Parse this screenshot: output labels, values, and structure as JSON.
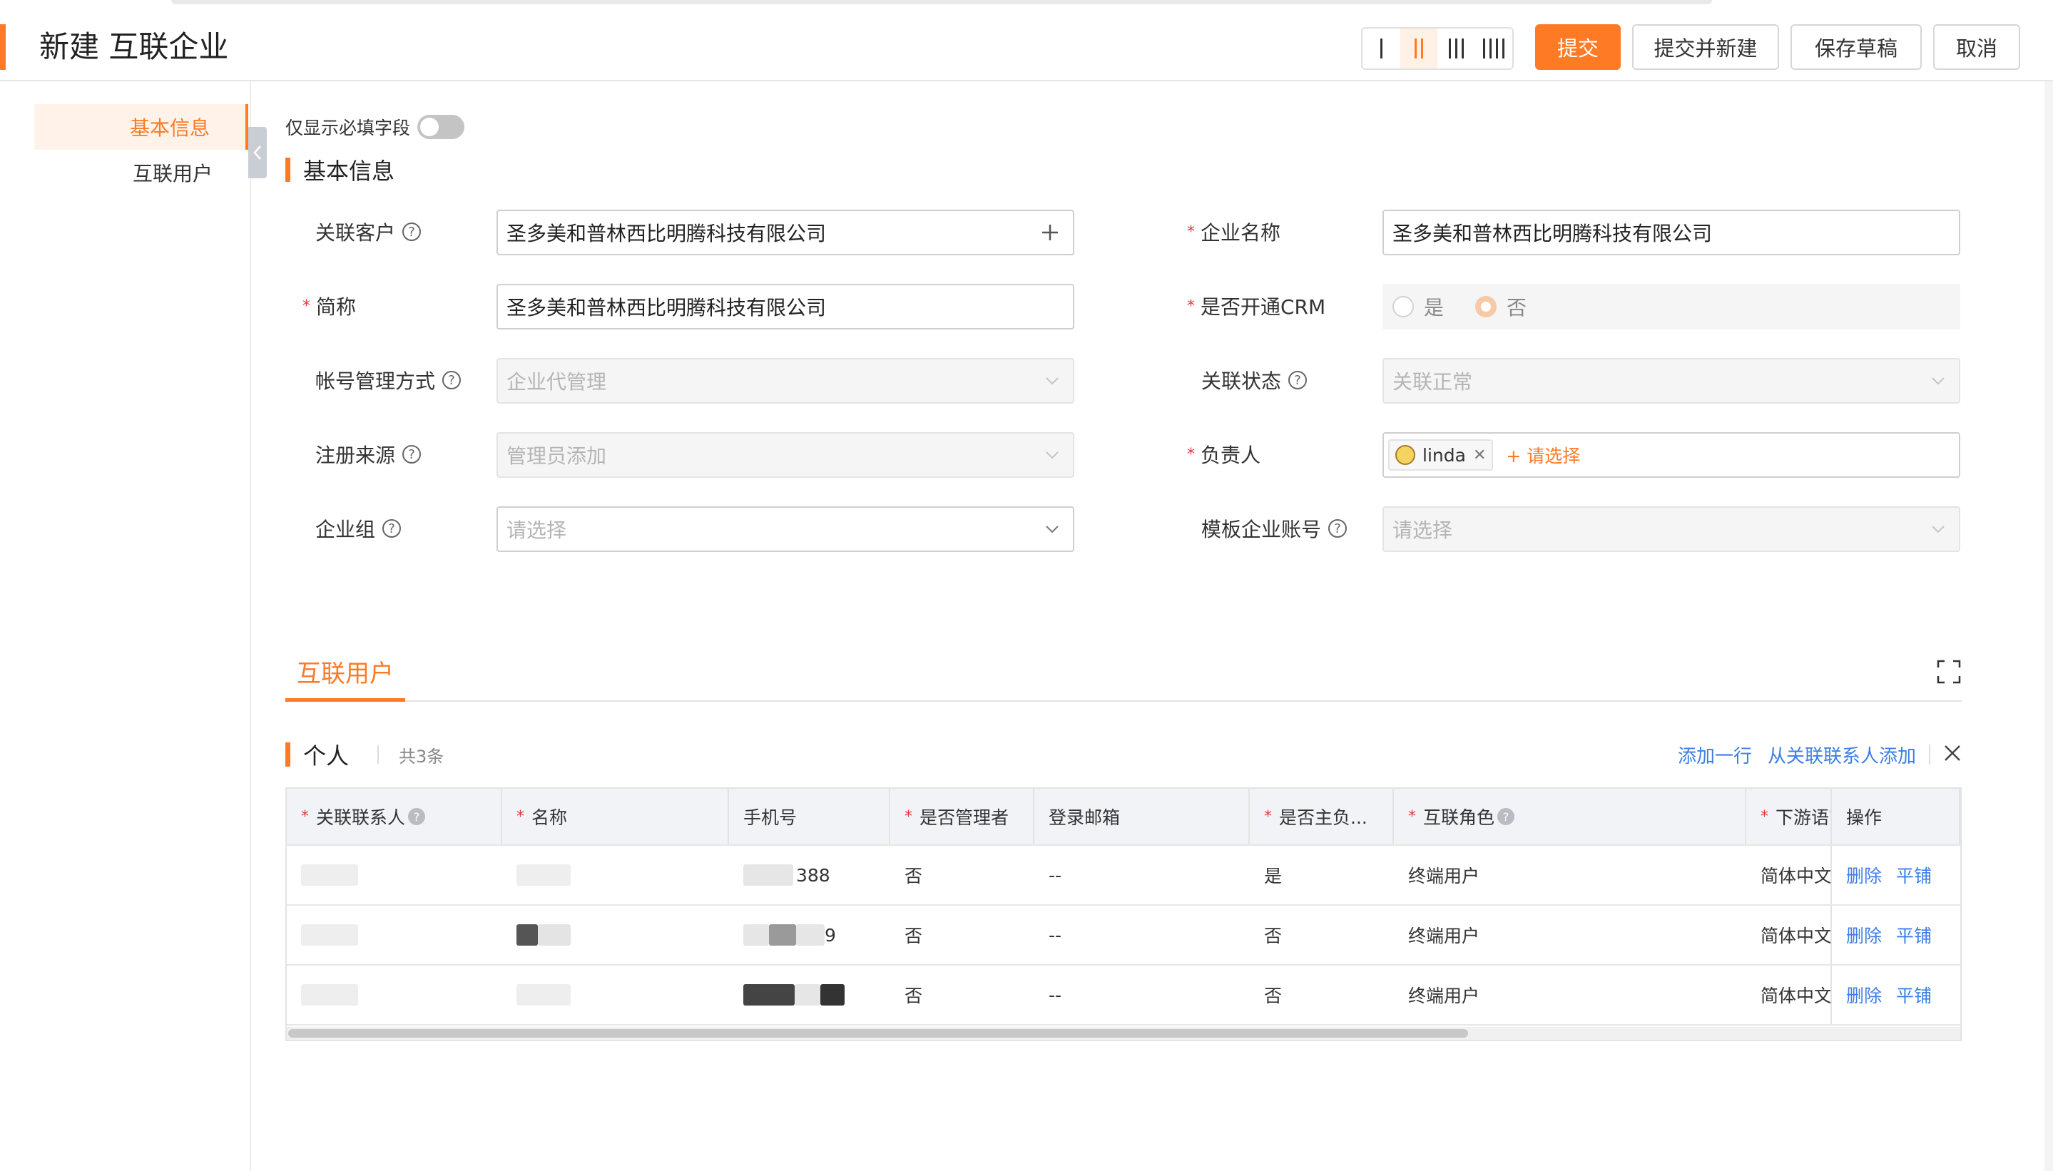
{
  "header": {
    "title": "新建 互联企业",
    "buttons": {
      "submit": "提交",
      "submit_new": "提交并新建",
      "save_draft": "保存草稿",
      "cancel": "取消"
    },
    "layout_options": [
      "single-column",
      "two-column",
      "three-column",
      "four-column"
    ],
    "active_layout": "two-column"
  },
  "sidebar": {
    "items": [
      {
        "label": "基本信息",
        "active": true
      },
      {
        "label": "互联用户",
        "active": false
      }
    ]
  },
  "form": {
    "required_only_label": "仅显示必填字段",
    "required_only_on": false,
    "section_title": "基本信息",
    "fields": {
      "related_customer": {
        "label": "关联客户",
        "value": "圣多美和普林西比明腾科技有限公司"
      },
      "company_name": {
        "label": "企业名称",
        "value": "圣多美和普林西比明腾科技有限公司"
      },
      "short_name": {
        "label": "简称",
        "value": "圣多美和普林西比明腾科技有限公司"
      },
      "open_crm": {
        "label": "是否开通CRM",
        "options": [
          "是",
          "否"
        ],
        "selected": "否"
      },
      "account_mgmt": {
        "label": "帐号管理方式",
        "value": "企业代管理"
      },
      "link_status": {
        "label": "关联状态",
        "value": "关联正常"
      },
      "reg_source": {
        "label": "注册来源",
        "value": "管理员添加"
      },
      "owner": {
        "label": "负责人",
        "tag": "linda",
        "add_label": "+ 请选择"
      },
      "company_group": {
        "label": "企业组",
        "placeholder": "请选择"
      },
      "template_account": {
        "label": "模板企业账号",
        "placeholder": "请选择"
      }
    }
  },
  "tabs": {
    "active": "互联用户"
  },
  "users": {
    "section_title": "个人",
    "count": "共3条",
    "actions": {
      "add_row": "添加一行",
      "add_from_contacts": "从关联联系人添加"
    },
    "columns": [
      "关联联系人",
      "名称",
      "手机号",
      "是否管理者",
      "登录邮箱",
      "是否主负...",
      "互联角色",
      "下游语言",
      "操作"
    ],
    "rows": [
      {
        "phone_tail": "388",
        "is_admin": "否",
        "email": "--",
        "is_main": "是",
        "role": "终端用户",
        "lang": "简体中文"
      },
      {
        "phone_tail": "9",
        "is_admin": "否",
        "email": "--",
        "is_main": "否",
        "role": "终端用户",
        "lang": "简体中文"
      },
      {
        "phone_tail": "",
        "is_admin": "否",
        "email": "--",
        "is_main": "否",
        "role": "终端用户",
        "lang": "简体中文"
      }
    ],
    "row_actions": {
      "delete": "删除",
      "tile": "平铺"
    }
  }
}
